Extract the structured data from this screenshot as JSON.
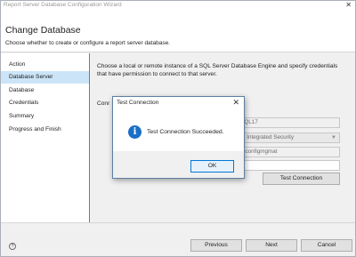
{
  "window": {
    "title": "Report Server Database Configuration Wizard",
    "close_glyph": "✕"
  },
  "header": {
    "title": "Change Database",
    "subtitle": "Choose whether to create or configure a report server database."
  },
  "sidebar": {
    "items": [
      {
        "label": "Action"
      },
      {
        "label": "Database Server"
      },
      {
        "label": "Database"
      },
      {
        "label": "Credentials"
      },
      {
        "label": "Summary"
      },
      {
        "label": "Progress and Finish"
      }
    ],
    "selected_index": 1
  },
  "content": {
    "description": "Choose a local or remote instance of a SQL Server Database Engine and specify credentials that have permission to connect to that server.",
    "connection_label_partial": "Conn",
    "server_value_partial": "SSQL17",
    "auth_value_partial": "er - Integrated Security",
    "username_value_partial": "svcconfigmgmat",
    "test_connection_label": "Test Connection"
  },
  "footer": {
    "help_glyph": "?",
    "previous_label": "Previous",
    "next_label": "Next",
    "cancel_label": "Cancel"
  },
  "dialog": {
    "title": "Test Connection",
    "close_glyph": "✕",
    "icon": "info-icon",
    "icon_glyph": "i",
    "message": "Test Connection Succeeded.",
    "ok_label": "OK"
  },
  "colors": {
    "selected_item": "#cce4f7",
    "info_blue": "#1a6fc6",
    "ok_border": "#0078d7"
  }
}
